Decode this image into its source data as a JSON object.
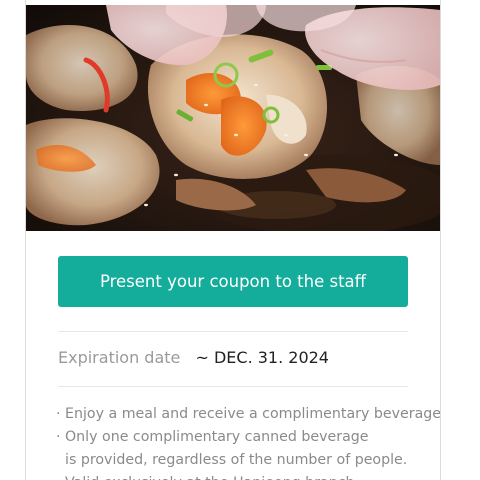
{
  "coupon": {
    "button_label": "Present your coupon to the staff",
    "expiration_label": "Expiration date",
    "expiration_value": "~ DEC. 31. 2024",
    "notes": [
      "· Enjoy a meal and receive a complimentary beverage.",
      "· Only one complimentary canned beverage",
      "is provided, regardless of the number of people.",
      "· Valid exclusively at the Hapjeong branch."
    ]
  },
  "colors": {
    "accent": "#14ad9b",
    "label_gray": "#9a9a9a",
    "value_dark": "#222222"
  },
  "icons": {
    "photo": "food-photo-crab"
  }
}
